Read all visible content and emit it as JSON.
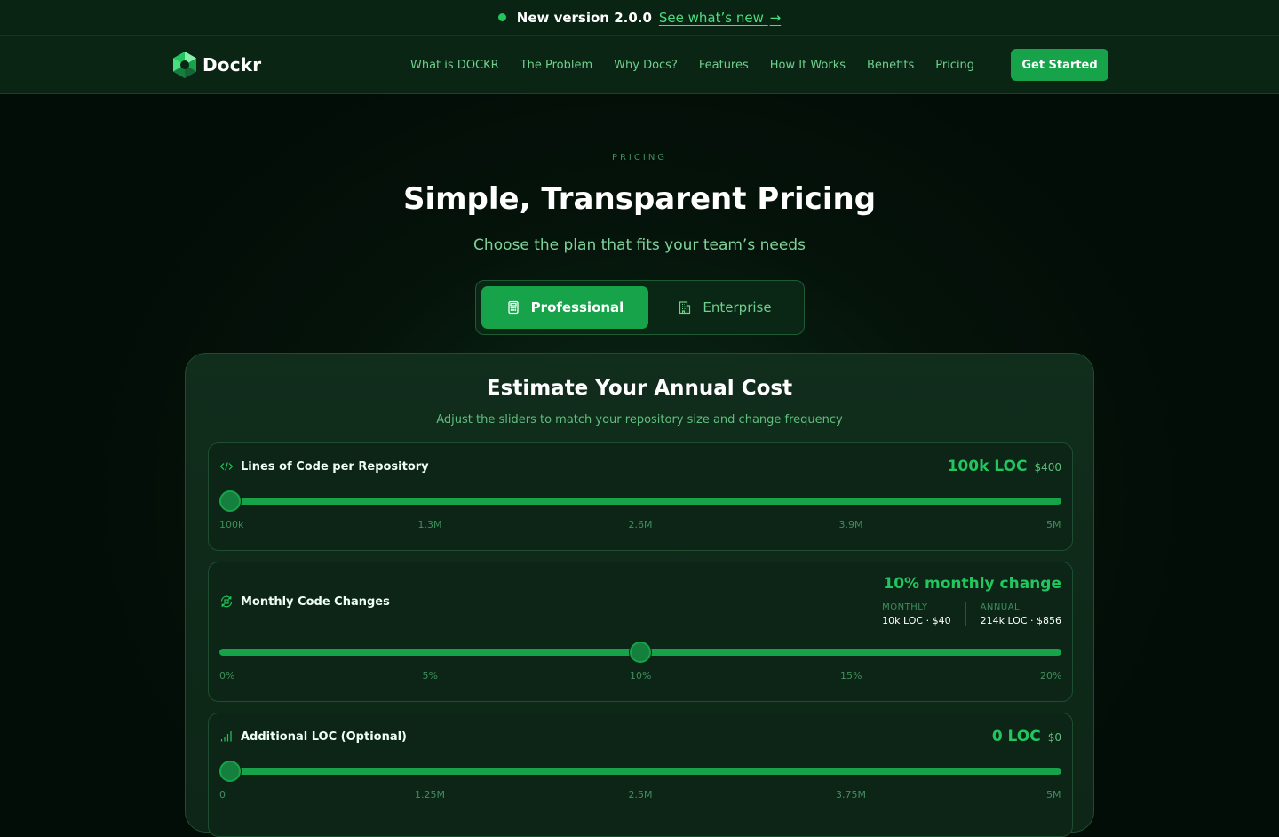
{
  "announcement": {
    "version": "New version 2.0.0",
    "link": "See what’s new",
    "arrow": "→"
  },
  "nav": {
    "brand": "Dockr",
    "links": [
      "What is DOCKR",
      "The Problem",
      "Why Docs?",
      "Features",
      "How It Works",
      "Benefits",
      "Pricing"
    ],
    "cta": "Get Started"
  },
  "hero": {
    "eyebrow": "PRICING",
    "title": "Simple, Transparent Pricing",
    "subtitle": "Choose the plan that fits your team’s needs"
  },
  "plans": {
    "active": "Professional",
    "options": [
      "Professional",
      "Enterprise"
    ]
  },
  "estimator": {
    "title": "Estimate Your Annual Cost",
    "subtitle": "Adjust the sliders to match your repository size and change frequency",
    "loc": {
      "label": "Lines of Code per Repository",
      "value": "100k LOC",
      "price": "$400",
      "level": 0,
      "ticks": [
        "100k",
        "1.3M",
        "2.6M",
        "3.9M",
        "5M"
      ]
    },
    "changes": {
      "label": "Monthly Code Changes",
      "value": "10% monthly change",
      "level": 0.5,
      "monthly_label": "MONTHLY",
      "monthly_value": "10k LOC · $40",
      "annual_label": "ANNUAL",
      "annual_value": "214k LOC · $856",
      "ticks": [
        "0%",
        "5%",
        "10%",
        "15%",
        "20%"
      ]
    },
    "additional": {
      "label": "Additional LOC (Optional)",
      "value": "0 LOC",
      "price": "$0",
      "level": 0,
      "ticks": [
        "0",
        "1.25M",
        "2.5M",
        "3.75M",
        "5M"
      ]
    }
  },
  "colors": {
    "accent": "#16a34a",
    "accent_text": "#22c55e",
    "background": "#030d07"
  }
}
